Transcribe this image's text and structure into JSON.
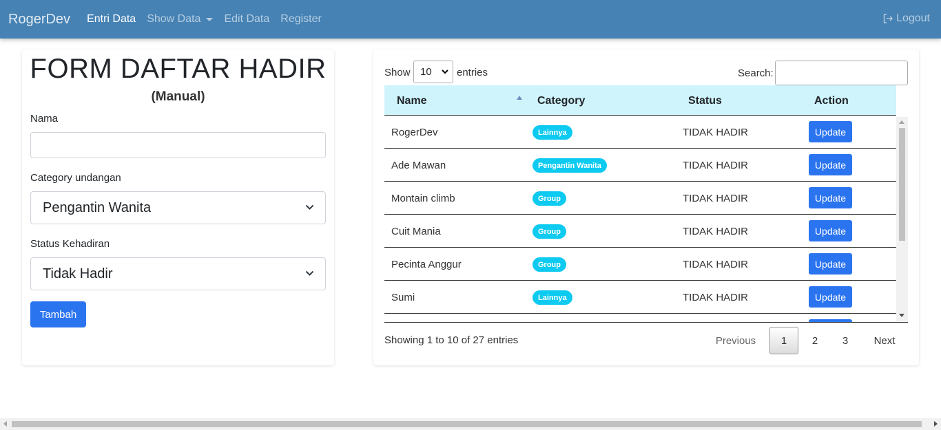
{
  "navbar": {
    "brand": "RogerDev",
    "links": [
      {
        "label": "Entri Data",
        "active": true
      },
      {
        "label": "Show Data",
        "dropdown": true
      },
      {
        "label": "Edit Data"
      },
      {
        "label": "Register"
      }
    ],
    "logout_label": "Logout",
    "logout_icon": "logout-icon",
    "color": "#4682b4"
  },
  "form": {
    "title": "FORM DAFTAR HADIR",
    "subtitle": "(Manual)",
    "nama_label": "Nama",
    "nama_value": "",
    "category_label": "Category undangan",
    "category_value": "Pengantin Wanita",
    "status_label": "Status Kehadiran",
    "status_value": "Tidak Hadir",
    "submit_label": "Tambah"
  },
  "table": {
    "show_label": "Show",
    "entries_label": "entries",
    "page_length": "10",
    "search_label": "Search:",
    "search_value": "",
    "columns": [
      "Name",
      "Category",
      "Status",
      "Action"
    ],
    "rows": [
      {
        "name": "RogerDev",
        "category": "Lainnya",
        "status": "TIDAK HADIR",
        "action": "Update"
      },
      {
        "name": "Ade Mawan",
        "category": "Pengantin Wanita",
        "status": "TIDAK HADIR",
        "action": "Update"
      },
      {
        "name": "Montain climb",
        "category": "Group",
        "status": "TIDAK HADIR",
        "action": "Update"
      },
      {
        "name": "Cuit Mania",
        "category": "Group",
        "status": "TIDAK HADIR",
        "action": "Update"
      },
      {
        "name": "Pecinta Anggur",
        "category": "Group",
        "status": "TIDAK HADIR",
        "action": "Update"
      },
      {
        "name": "Sumi",
        "category": "Lainnya",
        "status": "TIDAK HADIR",
        "action": "Update"
      }
    ],
    "info": "Showing 1 to 10 of 27 entries",
    "pagination": {
      "previous": "Previous",
      "pages": [
        "1",
        "2",
        "3"
      ],
      "current": "1",
      "next": "Next"
    },
    "header_color": "#cff4fc",
    "badge_color": "#0dcaf0",
    "button_color": "#2b74f0"
  }
}
